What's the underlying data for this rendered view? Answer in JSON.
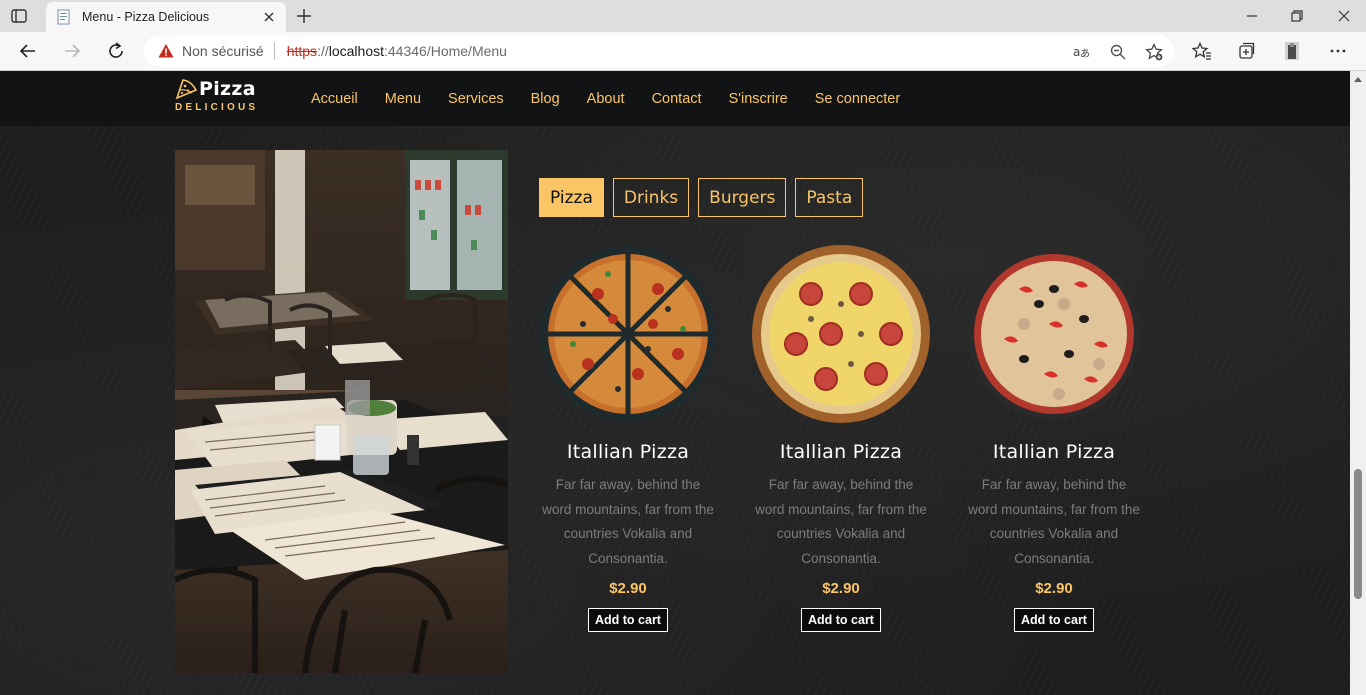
{
  "browser": {
    "tab_title": "Menu - Pizza Delicious",
    "security_label": "Non sécurisé",
    "url_scheme": "https",
    "url_sep": "://",
    "url_host": "localhost",
    "url_rest": ":44346/Home/Menu"
  },
  "site": {
    "logo_name": "Pizza",
    "logo_sub": "DELICIOUS",
    "nav": [
      "Accueil",
      "Menu",
      "Services",
      "Blog",
      "About",
      "Contact",
      "S'inscrire",
      "Se connecter"
    ]
  },
  "categories": [
    {
      "label": "Pizza",
      "active": true
    },
    {
      "label": "Drinks",
      "active": false
    },
    {
      "label": "Burgers",
      "active": false
    },
    {
      "label": "Pasta",
      "active": false
    }
  ],
  "items": [
    {
      "name": "Itallian Pizza",
      "description": "Far far away, behind the word mountains, far from the countries Vokalia and Consonantia.",
      "price": "$2.90",
      "button": "Add to cart"
    },
    {
      "name": "Itallian Pizza",
      "description": "Far far away, behind the word mountains, far from the countries Vokalia and Consonantia.",
      "price": "$2.90",
      "button": "Add to cart"
    },
    {
      "name": "Itallian Pizza",
      "description": "Far far away, behind the word mountains, far from the countries Vokalia and Consonantia.",
      "price": "$2.90",
      "button": "Add to cart"
    }
  ],
  "colors": {
    "accent": "#fac564",
    "nav_bg": "#111315",
    "warning": "#c42b1c"
  }
}
